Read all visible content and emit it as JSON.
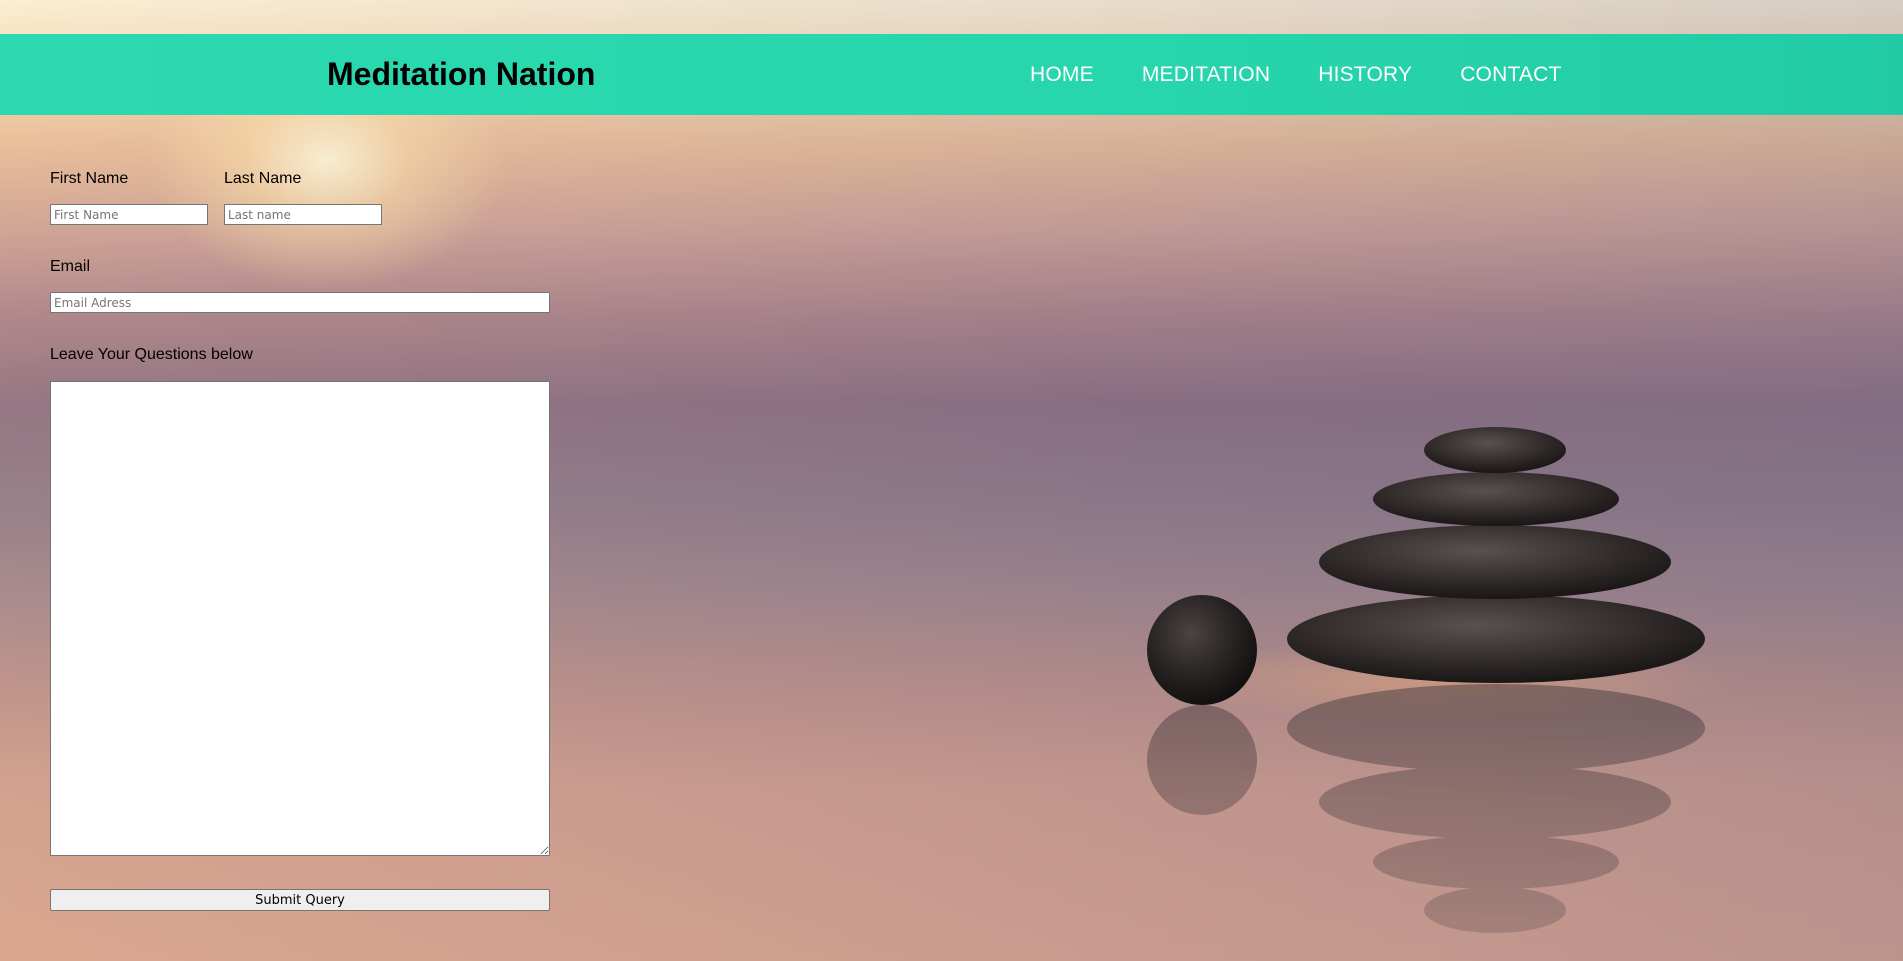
{
  "header": {
    "brand": "Meditation Nation",
    "nav": [
      {
        "label": "HOME"
      },
      {
        "label": "MEDITATION"
      },
      {
        "label": "HISTORY"
      },
      {
        "label": "CONTACT"
      }
    ]
  },
  "form": {
    "first_name_label": "First Name",
    "first_name_placeholder": "First Name",
    "first_name_value": "",
    "last_name_label": "Last Name",
    "last_name_placeholder": "Last name",
    "last_name_value": "",
    "email_label": "Email",
    "email_placeholder": "Email Adress",
    "email_value": "",
    "questions_label": "Leave Your Questions below",
    "questions_value": "",
    "submit_label": "Submit Query"
  },
  "colors": {
    "header_bg": "#2cd9b0",
    "nav_text": "#ffffff",
    "brand_text": "#000000"
  }
}
